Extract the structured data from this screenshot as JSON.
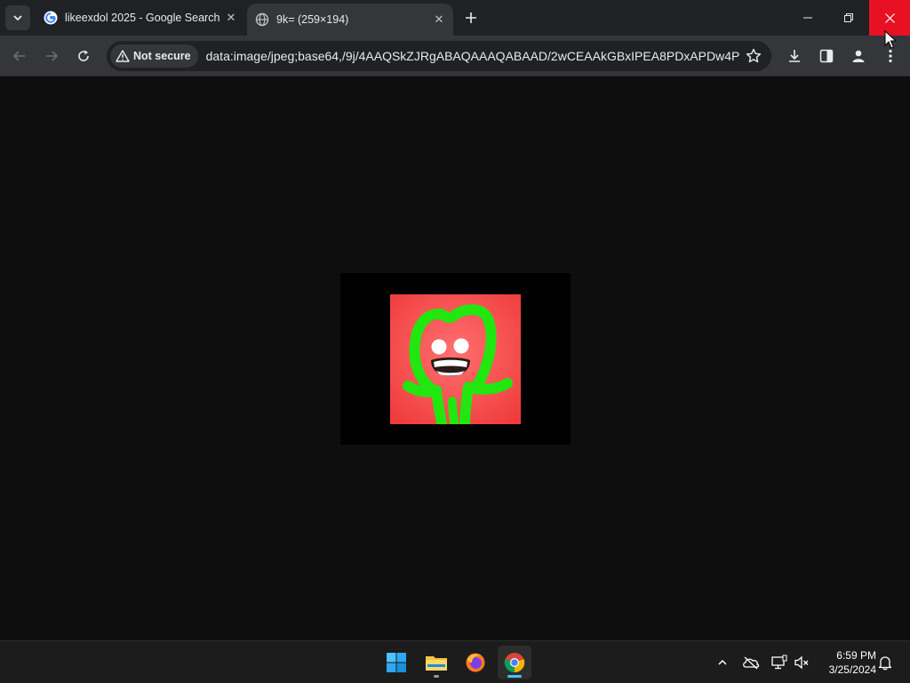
{
  "tabs": [
    {
      "title": "likeexdol 2025 - Google Search",
      "favicon": "google-g-icon",
      "active": false
    },
    {
      "title": "9k= (259×194)",
      "favicon": "globe-icon",
      "active": true
    }
  ],
  "toolbar": {
    "security_label": "Not secure",
    "url": "data:image/jpeg;base64,/9j/4AAQSkZJRgABAQAAAQABAAD/2wCEAAkGBxIPEA8PDxAPDw4PDw..."
  },
  "taskbar": {
    "apps": [
      "windows-start-icon",
      "file-explorer-icon",
      "firefox-icon",
      "chrome-icon"
    ],
    "time": "6:59 PM",
    "date": "3/25/2024"
  },
  "colors": {
    "close_red": "#e81123",
    "image_bg": "#f25050",
    "figure_green": "#22e60f"
  }
}
